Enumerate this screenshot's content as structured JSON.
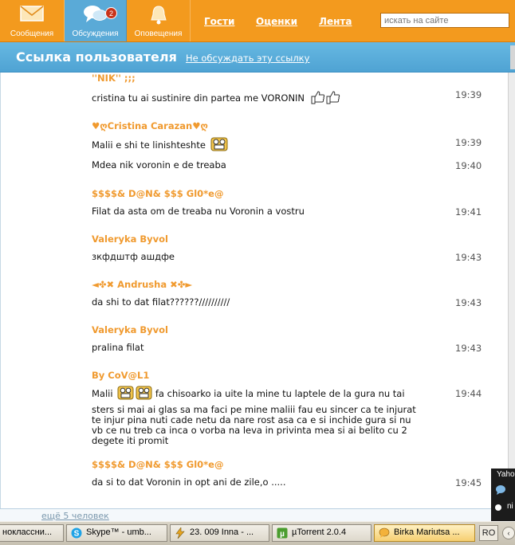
{
  "topbar": {
    "nav": [
      {
        "label": "Сообщения"
      },
      {
        "label": "Обсуждения",
        "badge": "2"
      },
      {
        "label": "Оповещения"
      }
    ],
    "links": [
      "Гости",
      "Оценки",
      "Лента"
    ],
    "search_placeholder": "искать на сайте"
  },
  "header": {
    "title": "Ссылка пользователя",
    "ignore_link": "Не обсуждать эту ссылку"
  },
  "messages": [
    {
      "author": "''NIK'' ;;;",
      "lines": [
        {
          "text": "cristina tu ai sustinire din partea me VORONIN",
          "time": "19:39"
        }
      ]
    },
    {
      "author": "♥ღCristina Carazan♥ღ",
      "lines": [
        {
          "text": "Malii e shi te linishteshte",
          "time": "19:39"
        },
        {
          "text": "Mdea nik voronin e de treaba",
          "time": "19:40"
        }
      ]
    },
    {
      "author": "$$$$& D@N& $$$ Gl0*e@",
      "lines": [
        {
          "text": "Filat da asta om de treaba nu Voronin a vostru",
          "time": "19:41"
        }
      ]
    },
    {
      "author": "Valeryka Byvol",
      "lines": [
        {
          "text": "зкфдштф ашдфе",
          "time": "19:43"
        }
      ]
    },
    {
      "author": "◄✤✖ Andrusha ✖✤►",
      "lines": [
        {
          "text": "da shi to dat filat??????//////////",
          "time": "19:43"
        }
      ]
    },
    {
      "author": "Valeryka Byvol",
      "lines": [
        {
          "text": "pralina filat",
          "time": "19:43"
        }
      ]
    },
    {
      "author": "By CoV@L1",
      "lines": [
        {
          "text_a": "Malii",
          "text_b": "fa chisoarko ia uite la mine tu laptele de la gura nu tai",
          "time": "19:44"
        },
        {
          "text": "sters si mai ai glas sa ma faci pe mine maliii fau eu sincer ca te injurat te injur pina nuti cade netu da nare rost asa ca e si inchide gura si nu vb ce nu treb ca inca o vorba na leva in privinta mea si ai belito cu 2 degete iti promit"
        }
      ]
    },
    {
      "author": "$$$$& D@N& $$$ Gl0*e@",
      "lines": [
        {
          "text": "da si to dat Voronin in opt ani de zile,o .....",
          "time": "19:45"
        }
      ]
    }
  ],
  "footer": {
    "more_link": "ещё 5 человек"
  },
  "yahoo": {
    "title": "Yaho",
    "item": "ni"
  },
  "taskbar": {
    "tasks": [
      {
        "label": "ноклассни..."
      },
      {
        "label": "Skype™ - umb..."
      },
      {
        "label": "23. 009 Inna - ..."
      },
      {
        "label": "µTorrent 2.0.4"
      },
      {
        "label": "Birka Mariutsa ..."
      }
    ],
    "lang": "RO"
  },
  "colors": {
    "orange": "#f39a1e",
    "blue": "#5aaad7",
    "author": "#f09a2f"
  }
}
